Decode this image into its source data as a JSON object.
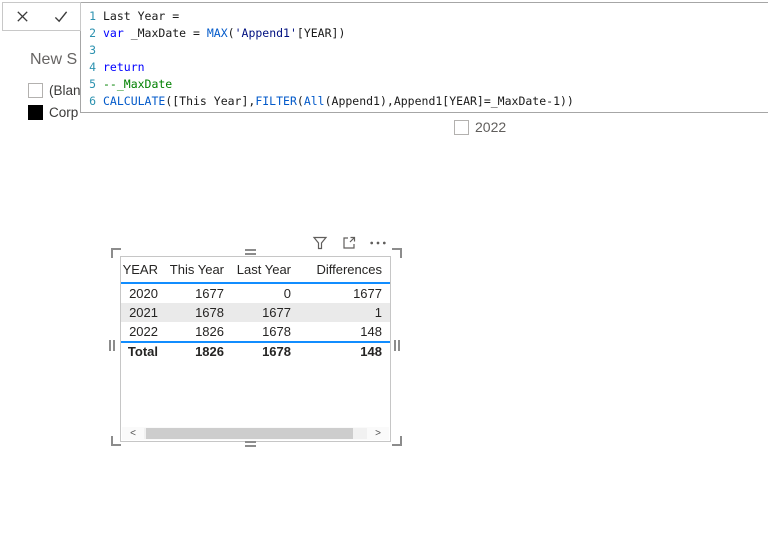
{
  "formula_bar": {
    "cancel_button": "cancel-formula",
    "commit_button": "commit-formula",
    "lines": [
      {
        "num": "1",
        "segments": [
          {
            "text": "Last Year =",
            "style": "tx"
          }
        ]
      },
      {
        "num": "2",
        "segments": [
          {
            "text": "var",
            "style": "kw"
          },
          {
            "text": " _MaxDate = ",
            "style": "tx"
          },
          {
            "text": "MAX",
            "style": "fn"
          },
          {
            "text": "(",
            "style": "tx"
          },
          {
            "text": "'Append1'",
            "style": "str"
          },
          {
            "text": "[YEAR])",
            "style": "tx"
          }
        ]
      },
      {
        "num": "3",
        "segments": []
      },
      {
        "num": "4",
        "segments": [
          {
            "text": "return",
            "style": "kw"
          }
        ]
      },
      {
        "num": "5",
        "segments": [
          {
            "text": "--_MaxDate",
            "style": "cm"
          }
        ]
      },
      {
        "num": "6",
        "segments": [
          {
            "text": "CALCULATE",
            "style": "fn"
          },
          {
            "text": "([This Year],",
            "style": "tx"
          },
          {
            "text": "FILTER",
            "style": "fn"
          },
          {
            "text": "(",
            "style": "tx"
          },
          {
            "text": "All",
            "style": "fn"
          },
          {
            "text": "(Append1),Append1[YEAR]=_MaxDate-1))",
            "style": "tx"
          }
        ]
      }
    ]
  },
  "segment_slicer": {
    "title": "New S",
    "items": [
      {
        "label": "(Blan",
        "checked": false
      },
      {
        "label": "Corp",
        "checked": true
      }
    ]
  },
  "year_slicer": {
    "items": [
      {
        "label": "2022",
        "checked": false
      }
    ]
  },
  "visual_header_icons": [
    "filter-icon",
    "focus-mode-icon",
    "more-options-icon"
  ],
  "table_visual": {
    "columns": [
      "YEAR",
      "This Year",
      "Last Year",
      "Differences"
    ],
    "rows": [
      {
        "cells": [
          "2020",
          "1677",
          "0",
          "1677"
        ],
        "highlight": false
      },
      {
        "cells": [
          "2021",
          "1678",
          "1677",
          "1"
        ],
        "highlight": true
      },
      {
        "cells": [
          "2022",
          "1826",
          "1678",
          "148"
        ],
        "highlight": false
      }
    ],
    "total": {
      "cells": [
        "Total",
        "1826",
        "1678",
        "148"
      ]
    },
    "scrollbar": {
      "left_arrow": "<",
      "right_arrow": ">"
    }
  },
  "colors": {
    "accent_blue": "#118dff",
    "row_highlight": "#eaeaea",
    "keyword": "#0000ff",
    "function": "#035aca",
    "comment": "#008000",
    "table_ref": "#001080",
    "line_number": "#2b91af"
  }
}
